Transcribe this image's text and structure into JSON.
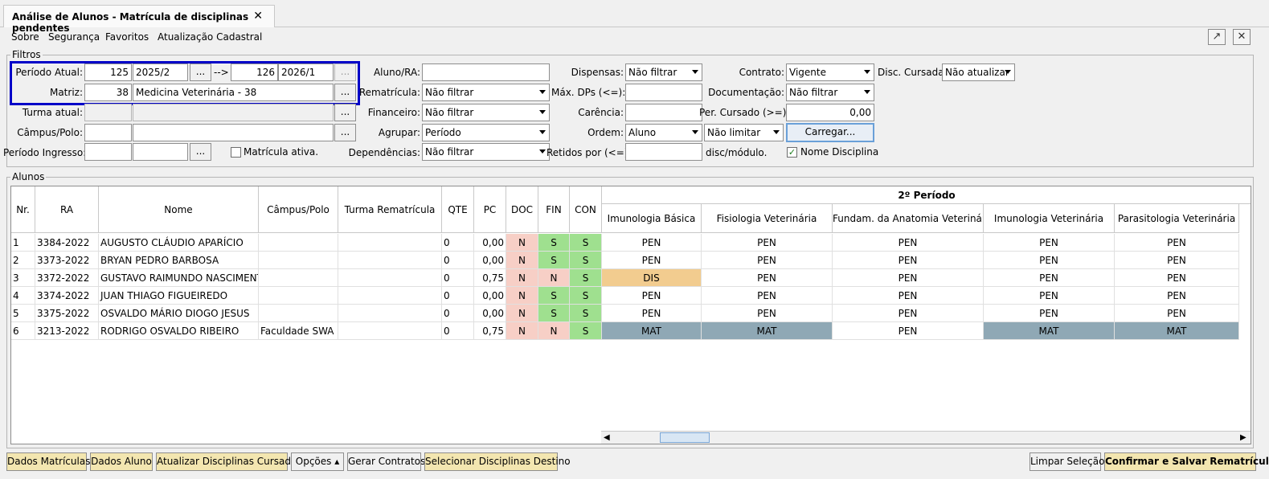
{
  "tab": {
    "title": "Análise de Alunos - Matrícula de disciplinas pendentes",
    "close": "✕"
  },
  "menu": [
    "Sobre",
    "Segurança",
    "Favoritos",
    "Atualização Cadastral"
  ],
  "window_buttons": {
    "popout": "↗",
    "close": "✕"
  },
  "filters": {
    "group_label": "Filtros",
    "periodo_atual": {
      "label": "Período Atual:",
      "code_from": "125",
      "value_from": "2025/2",
      "ellipsis": "...",
      "arrow": "-->",
      "code_to": "126",
      "value_to": "2026/1"
    },
    "matriz": {
      "label": "Matriz:",
      "code": "38",
      "value": "Medicina Veterinária - 38"
    },
    "turma_atual": {
      "label": "Turma atual:"
    },
    "campus_polo": {
      "label": "Câmpus/Polo:"
    },
    "periodo_ingresso": {
      "label": "Período Ingresso:"
    },
    "matricula_ativa": {
      "label": "Matrícula ativa.",
      "checked": false
    },
    "aluno_ra": {
      "label": "Aluno/RA:",
      "value": ""
    },
    "rematricula": {
      "label": "Rematrícula:",
      "value": "Não filtrar"
    },
    "financeiro": {
      "label": "Financeiro:",
      "value": "Não filtrar"
    },
    "agrupar": {
      "label": "Agrupar:",
      "value": "Período"
    },
    "dependencias": {
      "label": "Dependências:",
      "value": "Não filtrar"
    },
    "dispensas": {
      "label": "Dispensas:",
      "value": "Não filtrar"
    },
    "max_dps": {
      "label": "Máx. DPs (<=):",
      "value": ""
    },
    "carencia": {
      "label": "Carência:",
      "value": ""
    },
    "ordem": {
      "label": "Ordem:",
      "value": "Aluno",
      "limit": "Não limitar"
    },
    "retidos": {
      "label": "Retidos por (<=):",
      "value": "",
      "suffix": "disc/módulo."
    },
    "contrato": {
      "label": "Contrato:",
      "value": "Vigente"
    },
    "documentacao": {
      "label": "Documentação:",
      "value": "Não filtrar"
    },
    "per_cursado": {
      "label": "Per. Cursado (>=):",
      "value": "0,00"
    },
    "carregar_button": "Carregar...",
    "nome_disciplina": {
      "label": "Nome Disciplina",
      "checked": true
    },
    "disc_cursadas": {
      "label": "Disc. Cursadas:",
      "value": "Não atualizar"
    }
  },
  "alunos": {
    "group_label": "Alunos",
    "period_header": "2º Período",
    "columns": [
      "Nr.",
      "RA",
      "Nome",
      "Câmpus/Polo",
      "Turma Rematrícula",
      "QTE",
      "PC",
      "DOC",
      "FIN",
      "CON"
    ],
    "discipline_columns": [
      "Imunologia Básica",
      "Fisiologia Veterinária",
      "Fundam. da Anatomia Veterinária...",
      "Imunologia Veterinária",
      "Parasitologia Veterinária"
    ],
    "rows": [
      {
        "nr": "1",
        "ra": "3384-2022",
        "nome": "AUGUSTO CLÁUDIO APARÍCIO",
        "campus": "",
        "turma": "",
        "qte": "0",
        "pc": "0,00",
        "doc": "N",
        "fin": "S",
        "con": "S",
        "disc": [
          "PEN",
          "PEN",
          "PEN",
          "PEN",
          "PEN"
        ]
      },
      {
        "nr": "2",
        "ra": "3373-2022",
        "nome": "BRYAN PEDRO BARBOSA",
        "campus": "",
        "turma": "",
        "qte": "0",
        "pc": "0,00",
        "doc": "N",
        "fin": "S",
        "con": "S",
        "disc": [
          "PEN",
          "PEN",
          "PEN",
          "PEN",
          "PEN"
        ]
      },
      {
        "nr": "3",
        "ra": "3372-2022",
        "nome": "GUSTAVO RAIMUNDO NASCIMENTO",
        "campus": "",
        "turma": "",
        "qte": "0",
        "pc": "0,75",
        "doc": "N",
        "fin": "N",
        "con": "S",
        "disc": [
          "DIS",
          "PEN",
          "PEN",
          "PEN",
          "PEN"
        ]
      },
      {
        "nr": "4",
        "ra": "3374-2022",
        "nome": "JUAN THIAGO FIGUEIREDO",
        "campus": "",
        "turma": "",
        "qte": "0",
        "pc": "0,00",
        "doc": "N",
        "fin": "S",
        "con": "S",
        "disc": [
          "PEN",
          "PEN",
          "PEN",
          "PEN",
          "PEN"
        ]
      },
      {
        "nr": "5",
        "ra": "3375-2022",
        "nome": "OSVALDO MÁRIO DIOGO JESUS",
        "campus": "",
        "turma": "",
        "qte": "0",
        "pc": "0,00",
        "doc": "N",
        "fin": "S",
        "con": "S",
        "disc": [
          "PEN",
          "PEN",
          "PEN",
          "PEN",
          "PEN"
        ]
      },
      {
        "nr": "6",
        "ra": "3213-2022",
        "nome": "RODRIGO OSVALDO RIBEIRO",
        "campus": "Faculdade SWA ...",
        "turma": "",
        "qte": "0",
        "pc": "0,75",
        "doc": "N",
        "fin": "N",
        "con": "S",
        "disc": [
          "MAT",
          "MAT",
          "PEN",
          "MAT",
          "MAT"
        ]
      }
    ]
  },
  "status_colors": {
    "doc_n": "#f7cfc6",
    "yes": "#9fe08f",
    "dis": "#f2cc8f",
    "mat": "#8fa8b5",
    "selection_frame": "#0000c8"
  },
  "bottom_buttons": {
    "dados_matriculas": "Dados Matrículas",
    "dados_aluno": "Dados Aluno",
    "atualizar_disciplinas": "Atualizar Disciplinas Cursadas",
    "opcoes": "Opções",
    "gerar_contratos": "Gerar Contratos",
    "selecionar_destino": "Selecionar Disciplinas Destino",
    "limpar_selecao": "Limpar Seleção",
    "confirmar_salvar": "Confirmar e Salvar Rematrículas"
  }
}
